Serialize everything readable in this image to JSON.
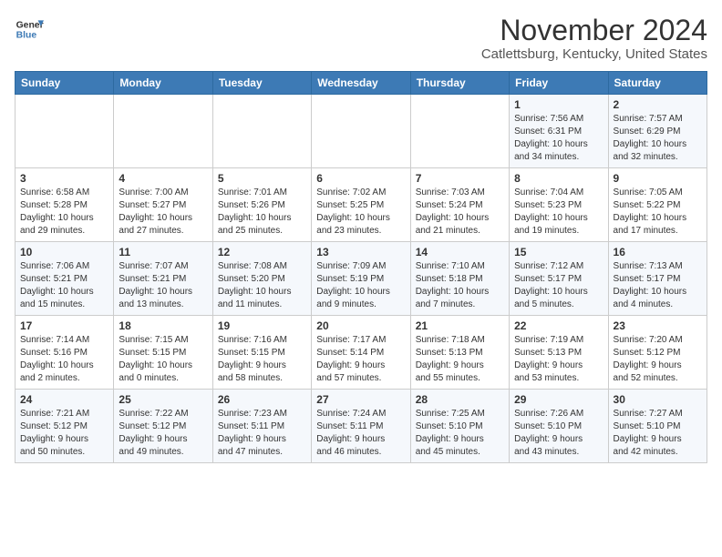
{
  "logo": {
    "line1": "General",
    "line2": "Blue"
  },
  "title": "November 2024",
  "subtitle": "Catlettsburg, Kentucky, United States",
  "days_of_week": [
    "Sunday",
    "Monday",
    "Tuesday",
    "Wednesday",
    "Thursday",
    "Friday",
    "Saturday"
  ],
  "weeks": [
    [
      {
        "day": "",
        "info": ""
      },
      {
        "day": "",
        "info": ""
      },
      {
        "day": "",
        "info": ""
      },
      {
        "day": "",
        "info": ""
      },
      {
        "day": "",
        "info": ""
      },
      {
        "day": "1",
        "info": "Sunrise: 7:56 AM\nSunset: 6:31 PM\nDaylight: 10 hours\nand 34 minutes."
      },
      {
        "day": "2",
        "info": "Sunrise: 7:57 AM\nSunset: 6:29 PM\nDaylight: 10 hours\nand 32 minutes."
      }
    ],
    [
      {
        "day": "3",
        "info": "Sunrise: 6:58 AM\nSunset: 5:28 PM\nDaylight: 10 hours\nand 29 minutes."
      },
      {
        "day": "4",
        "info": "Sunrise: 7:00 AM\nSunset: 5:27 PM\nDaylight: 10 hours\nand 27 minutes."
      },
      {
        "day": "5",
        "info": "Sunrise: 7:01 AM\nSunset: 5:26 PM\nDaylight: 10 hours\nand 25 minutes."
      },
      {
        "day": "6",
        "info": "Sunrise: 7:02 AM\nSunset: 5:25 PM\nDaylight: 10 hours\nand 23 minutes."
      },
      {
        "day": "7",
        "info": "Sunrise: 7:03 AM\nSunset: 5:24 PM\nDaylight: 10 hours\nand 21 minutes."
      },
      {
        "day": "8",
        "info": "Sunrise: 7:04 AM\nSunset: 5:23 PM\nDaylight: 10 hours\nand 19 minutes."
      },
      {
        "day": "9",
        "info": "Sunrise: 7:05 AM\nSunset: 5:22 PM\nDaylight: 10 hours\nand 17 minutes."
      }
    ],
    [
      {
        "day": "10",
        "info": "Sunrise: 7:06 AM\nSunset: 5:21 PM\nDaylight: 10 hours\nand 15 minutes."
      },
      {
        "day": "11",
        "info": "Sunrise: 7:07 AM\nSunset: 5:21 PM\nDaylight: 10 hours\nand 13 minutes."
      },
      {
        "day": "12",
        "info": "Sunrise: 7:08 AM\nSunset: 5:20 PM\nDaylight: 10 hours\nand 11 minutes."
      },
      {
        "day": "13",
        "info": "Sunrise: 7:09 AM\nSunset: 5:19 PM\nDaylight: 10 hours\nand 9 minutes."
      },
      {
        "day": "14",
        "info": "Sunrise: 7:10 AM\nSunset: 5:18 PM\nDaylight: 10 hours\nand 7 minutes."
      },
      {
        "day": "15",
        "info": "Sunrise: 7:12 AM\nSunset: 5:17 PM\nDaylight: 10 hours\nand 5 minutes."
      },
      {
        "day": "16",
        "info": "Sunrise: 7:13 AM\nSunset: 5:17 PM\nDaylight: 10 hours\nand 4 minutes."
      }
    ],
    [
      {
        "day": "17",
        "info": "Sunrise: 7:14 AM\nSunset: 5:16 PM\nDaylight: 10 hours\nand 2 minutes."
      },
      {
        "day": "18",
        "info": "Sunrise: 7:15 AM\nSunset: 5:15 PM\nDaylight: 10 hours\nand 0 minutes."
      },
      {
        "day": "19",
        "info": "Sunrise: 7:16 AM\nSunset: 5:15 PM\nDaylight: 9 hours\nand 58 minutes."
      },
      {
        "day": "20",
        "info": "Sunrise: 7:17 AM\nSunset: 5:14 PM\nDaylight: 9 hours\nand 57 minutes."
      },
      {
        "day": "21",
        "info": "Sunrise: 7:18 AM\nSunset: 5:13 PM\nDaylight: 9 hours\nand 55 minutes."
      },
      {
        "day": "22",
        "info": "Sunrise: 7:19 AM\nSunset: 5:13 PM\nDaylight: 9 hours\nand 53 minutes."
      },
      {
        "day": "23",
        "info": "Sunrise: 7:20 AM\nSunset: 5:12 PM\nDaylight: 9 hours\nand 52 minutes."
      }
    ],
    [
      {
        "day": "24",
        "info": "Sunrise: 7:21 AM\nSunset: 5:12 PM\nDaylight: 9 hours\nand 50 minutes."
      },
      {
        "day": "25",
        "info": "Sunrise: 7:22 AM\nSunset: 5:12 PM\nDaylight: 9 hours\nand 49 minutes."
      },
      {
        "day": "26",
        "info": "Sunrise: 7:23 AM\nSunset: 5:11 PM\nDaylight: 9 hours\nand 47 minutes."
      },
      {
        "day": "27",
        "info": "Sunrise: 7:24 AM\nSunset: 5:11 PM\nDaylight: 9 hours\nand 46 minutes."
      },
      {
        "day": "28",
        "info": "Sunrise: 7:25 AM\nSunset: 5:10 PM\nDaylight: 9 hours\nand 45 minutes."
      },
      {
        "day": "29",
        "info": "Sunrise: 7:26 AM\nSunset: 5:10 PM\nDaylight: 9 hours\nand 43 minutes."
      },
      {
        "day": "30",
        "info": "Sunrise: 7:27 AM\nSunset: 5:10 PM\nDaylight: 9 hours\nand 42 minutes."
      }
    ]
  ]
}
